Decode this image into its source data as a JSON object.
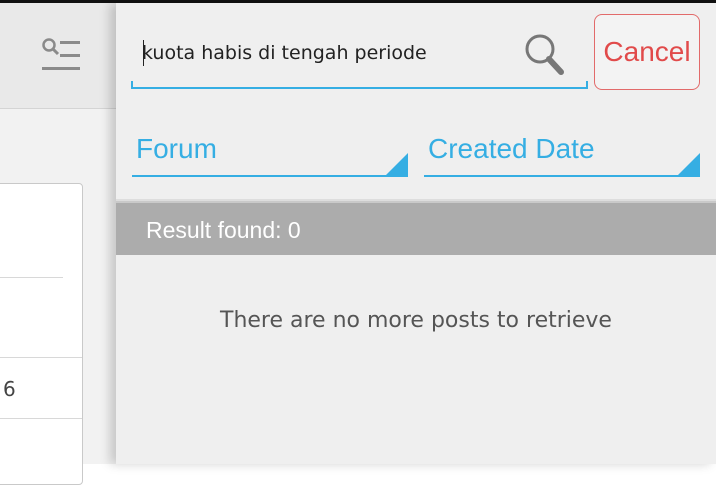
{
  "background": {
    "card_number": "6"
  },
  "search": {
    "query": "kuota habis di tengah periode",
    "cancel_label": "Cancel"
  },
  "filters": {
    "forum_label": "Forum",
    "date_label": "Created Date"
  },
  "results": {
    "found_text": "Result found: 0",
    "empty_message": "There are no more posts to retrieve"
  },
  "colors": {
    "accent": "#35aee3",
    "cancel": "#e14a4a",
    "result_bar": "#acacac"
  }
}
